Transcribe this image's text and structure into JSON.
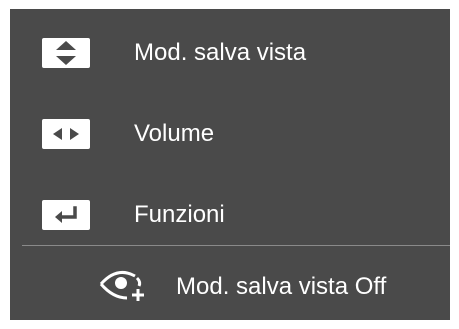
{
  "menu": {
    "items": [
      {
        "label": "Mod. salva vista",
        "key_icon": "up-down-arrows-icon"
      },
      {
        "label": "Volume",
        "key_icon": "left-right-arrows-icon"
      },
      {
        "label": "Funzioni",
        "key_icon": "enter-return-icon"
      }
    ]
  },
  "status": {
    "icon": "eye-saver-icon",
    "text": "Mod. salva vista Off"
  },
  "colors": {
    "panel_background": "#4a4a4a",
    "key_background": "#ffffff",
    "key_glyph": "#4a4a4a",
    "text": "#ffffff",
    "divider": "#8a8a8a"
  }
}
